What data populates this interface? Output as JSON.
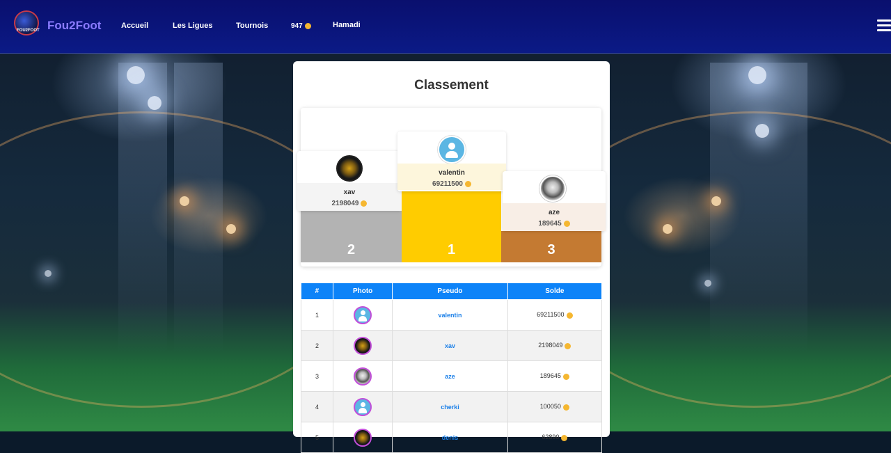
{
  "nav": {
    "logo_text": "FOU2FOOT",
    "brand": "Fou2Foot",
    "links": [
      "Accueil",
      "Les Ligues",
      "Tournois"
    ],
    "coins": "947",
    "user": "Hamadi"
  },
  "page": {
    "title": "Classement"
  },
  "podium": [
    {
      "rank": "2",
      "name": "xav",
      "score": "2198049",
      "avatar": "dark-avatar"
    },
    {
      "rank": "1",
      "name": "valentin",
      "score": "69211500",
      "avatar": "default-user-avatar"
    },
    {
      "rank": "3",
      "name": "aze",
      "score": "189645",
      "avatar": "face-avatar"
    }
  ],
  "table": {
    "headers": [
      "#",
      "Photo",
      "Pseudo",
      "Solde"
    ],
    "rows": [
      {
        "rank": "1",
        "pseudo": "valentin",
        "solde": "69211500"
      },
      {
        "rank": "2",
        "pseudo": "xav",
        "solde": "2198049"
      },
      {
        "rank": "3",
        "pseudo": "aze",
        "solde": "189645"
      },
      {
        "rank": "4",
        "pseudo": "cherki",
        "solde": "100050"
      },
      {
        "rank": "5",
        "pseudo": "denis",
        "solde": "62890"
      }
    ]
  },
  "colors": {
    "navbar": "#0a0f6e",
    "brand": "#8b7bff",
    "gold": "#ffcc00",
    "silver": "#b3b3b3",
    "bronze": "#c47a32",
    "table_header": "#0d83f8",
    "coin": "#f5b731"
  }
}
